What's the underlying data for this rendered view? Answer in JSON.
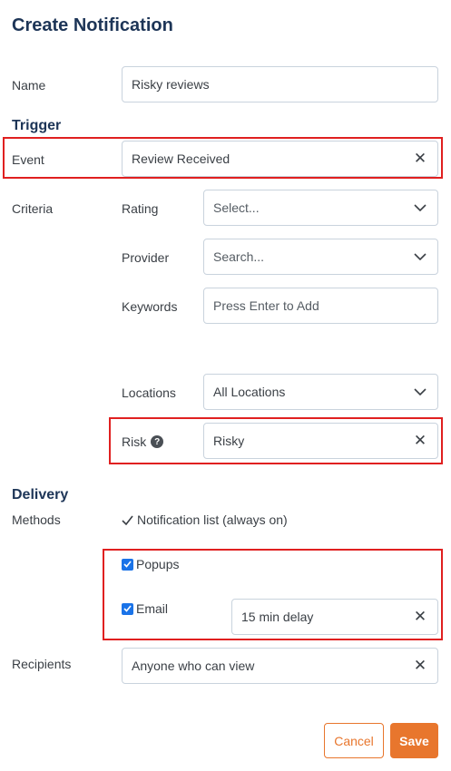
{
  "title": "Create Notification",
  "name": {
    "label": "Name",
    "value": "Risky reviews"
  },
  "trigger": {
    "heading": "Trigger",
    "event": {
      "label": "Event",
      "value": "Review Received"
    },
    "criteria": {
      "label": "Criteria",
      "rating": {
        "label": "Rating",
        "placeholder": "Select..."
      },
      "provider": {
        "label": "Provider",
        "placeholder": "Search..."
      },
      "keywords": {
        "label": "Keywords",
        "placeholder": "Press Enter to Add"
      },
      "locations": {
        "label": "Locations",
        "value": "All Locations"
      },
      "risk": {
        "label": "Risk",
        "value": "Risky"
      }
    }
  },
  "delivery": {
    "heading": "Delivery",
    "methods_label": "Methods",
    "always_on": "Notification list (always on)",
    "popups": {
      "label": "Popups",
      "checked": true
    },
    "email": {
      "label": "Email",
      "checked": true,
      "delay": "15 min delay"
    },
    "recipients": {
      "label": "Recipients",
      "value": "Anyone who can view"
    }
  },
  "actions": {
    "cancel": "Cancel",
    "save": "Save"
  },
  "colors": {
    "accent": "#e8762d",
    "heading": "#1d3557",
    "highlight": "#e02020",
    "checkbox": "#1a73e8"
  }
}
